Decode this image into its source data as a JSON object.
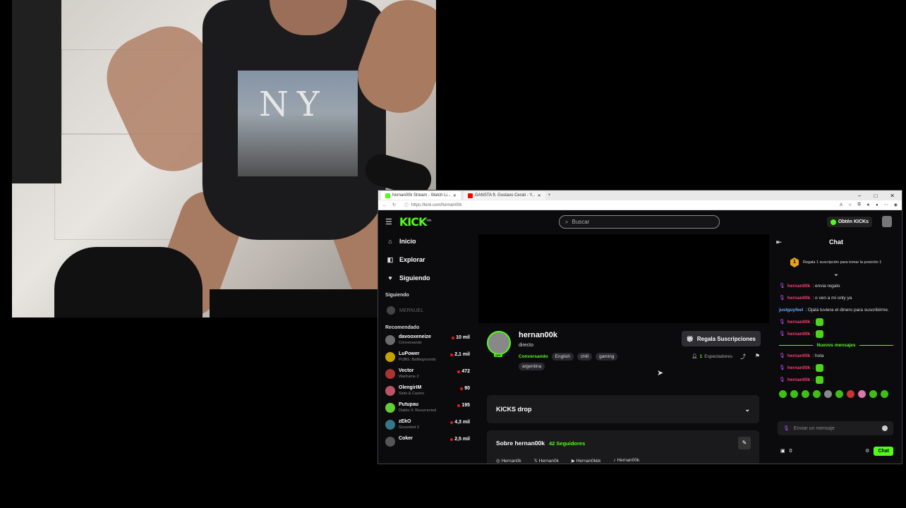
{
  "webcam": {
    "shirt_text": "NY"
  },
  "browser": {
    "tabs": [
      {
        "label": "hernan00k Stream - Watch Li...",
        "favicon_color": "#53fc18",
        "active": true
      },
      {
        "label": "GANSTA ft. Gustavo Cerati - Y...",
        "favicon_color": "#ff0000",
        "active": false
      }
    ],
    "new_tab": "+",
    "controls": {
      "minimize": "–",
      "maximize": "□",
      "close": "✕"
    },
    "url": "https://kick.com/hernan00k"
  },
  "kick": {
    "logo": "KICK",
    "logo_beta": "beta",
    "search_placeholder": "Buscar",
    "get_kicks": "Obtén KICKs",
    "nav": [
      {
        "icon": "home-icon",
        "glyph": "⌂",
        "label": "Inicio"
      },
      {
        "icon": "compass-icon",
        "glyph": "◧",
        "label": "Explorar"
      },
      {
        "icon": "heart-icon",
        "glyph": "♥",
        "label": "Siguiendo"
      }
    ],
    "following_heading": "Siguiendo",
    "following": [
      {
        "name": "MERNUEL"
      }
    ],
    "recommended_heading": "Recomendado",
    "recommended": [
      {
        "name": "davooxeneize",
        "category": "Conversando",
        "viewers": "10 mil",
        "color": "#6b6b6b"
      },
      {
        "name": "LuPower",
        "category": "PUBG: Battlegrounds",
        "viewers": "2,1 mil",
        "color": "#c5a200"
      },
      {
        "name": "Vector",
        "category": "Warframe 2",
        "viewers": "472",
        "color": "#a33"
      },
      {
        "name": "OlengirIM",
        "category": "Slots & Casino",
        "viewers": "90",
        "color": "#b56"
      },
      {
        "name": "Putupau",
        "category": "Diablo II: Resurrected",
        "viewers": "195",
        "color": "#6c3"
      },
      {
        "name": "zEkO",
        "category": "Grounded 2",
        "viewers": "4,3 mil",
        "color": "#378"
      },
      {
        "name": "Coker",
        "category": "",
        "viewers": "2,5 mil",
        "color": "#555"
      }
    ],
    "stream": {
      "username": "hernan00k",
      "title": "directo",
      "badge": "OFF",
      "category": "Conversando",
      "tags": [
        "English",
        "chill",
        "gaming"
      ],
      "tags2": [
        "argentina"
      ],
      "gift_subs": "Regala Suscripciones",
      "viewer_count": "1",
      "viewer_label": "Espectadores"
    },
    "kicks_drop": "KICKS drop",
    "about": {
      "title": "Sobre hernan00k",
      "followers": "42",
      "followers_label": "Seguidores",
      "socials": [
        "Hernan0k",
        "Hernan0k",
        "Hernan0kkk",
        "Hernan00k"
      ]
    },
    "chat": {
      "title": "Chat",
      "pinned_num": "1",
      "pinned_text": "Regala 1 suscripción para tomar la posición 1",
      "messages": [
        {
          "user": "hernan00k",
          "text": ": envia regalo",
          "mic": true
        },
        {
          "user": "hernan00k",
          "text": ": o ven a mi only ya",
          "mic": true
        },
        {
          "user": "justguyfeel",
          "text": ": Ojalá tuviera el dinero para suscribirme.",
          "mic": false,
          "blue": true
        },
        {
          "user": "hernan00k",
          "text": ":",
          "mic": true,
          "emote": true
        },
        {
          "user": "hernan00k",
          "text": ":",
          "mic": true,
          "emote": true
        }
      ],
      "new_messages": "Nuevos mensajes",
      "messages2": [
        {
          "user": "hernan00k",
          "text": ": hola",
          "mic": true
        },
        {
          "user": "hernan00k",
          "text": ":",
          "mic": true,
          "emote": true
        },
        {
          "user": "hernan00k",
          "text": ":",
          "mic": true,
          "emote": true
        }
      ],
      "input_placeholder": "Enviar un mensaje",
      "kicks_balance": "0",
      "send": "Chat"
    }
  }
}
